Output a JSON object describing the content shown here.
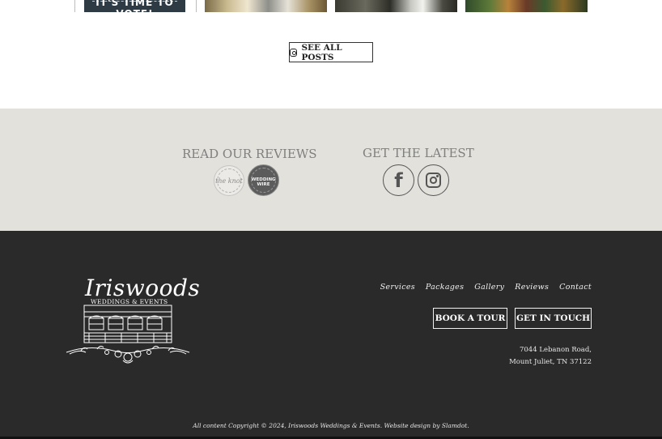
{
  "recent_posts": {
    "first_post_text": "IT'S TIME TO VOTE!",
    "see_all_label": "SEE ALL POSTS",
    "see_all_icon": "instagram-icon"
  },
  "reviews_band": {
    "reviews_heading": "READ OUR REVIEWS",
    "knot_badge": "the knot",
    "weddingwire_badge_line1": "WEDDING",
    "weddingwire_badge_line2": "WIRE",
    "latest_heading": "GET THE LATEST",
    "social_icons": [
      "facebook-icon",
      "instagram-icon"
    ],
    "background_color": "#e2e1dc"
  },
  "footer": {
    "logo_script": "Iriswoods",
    "logo_subtitle": "WEDDINGS & EVENTS",
    "nav": [
      "Services",
      "Packages",
      "Gallery",
      "Reviews",
      "Contact"
    ],
    "book_tour_label": "BOOK A TOUR",
    "get_in_touch_label": "GET IN TOUCH",
    "address_line1": "7044 Lebanon Road,",
    "address_line2": "Mount Juliet, TN 37122",
    "copyright": "All content Copyright © 2024, Iriswoods Weddings & Events. Website design by Slamdot.",
    "background_color": "#2a2a2a"
  }
}
